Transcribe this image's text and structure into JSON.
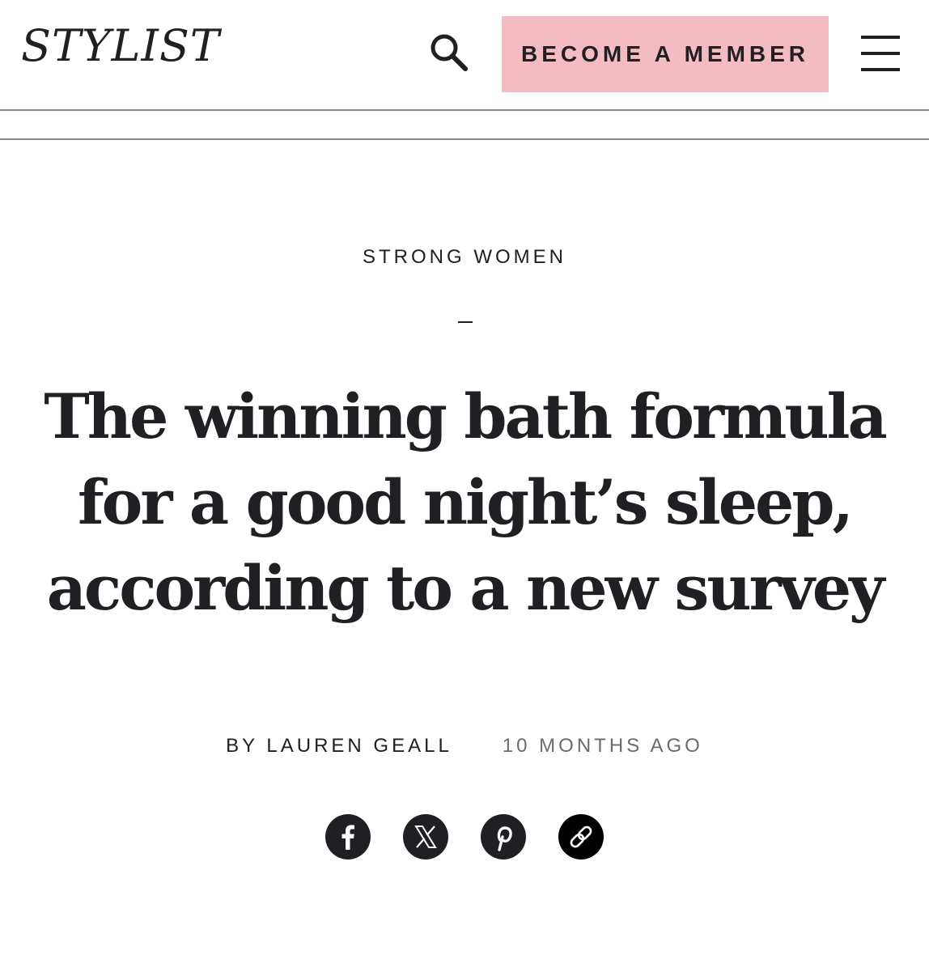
{
  "header": {
    "logo": "STYLIST",
    "member_button": "BECOME A MEMBER",
    "search_icon": "search-icon",
    "menu_icon": "hamburger-menu-icon"
  },
  "article": {
    "category": "STRONG WOMEN",
    "headline": "The winning bath formula for a good night’s sleep, according to a new survey",
    "byline": "BY LAUREN GEALL",
    "timestamp": "10 MONTHS AGO"
  },
  "share": {
    "icons": [
      "facebook-icon",
      "x-icon",
      "pinterest-icon",
      "link-icon"
    ]
  },
  "colors": {
    "text": "#1f1f24",
    "member_button_bg": "#f3bcc3",
    "muted": "#6b6b6b",
    "divider": "#8a8a8a"
  }
}
